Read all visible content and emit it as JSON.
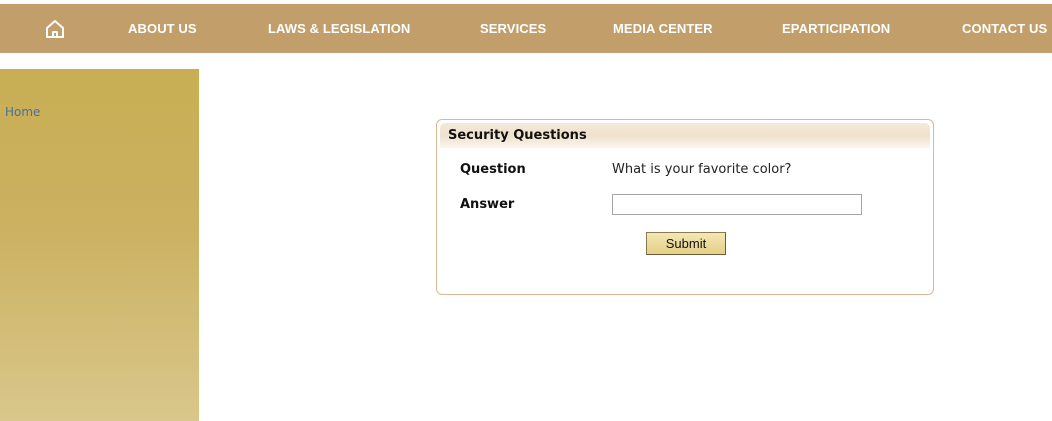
{
  "nav": {
    "home_icon": "home-icon",
    "items": [
      {
        "label": "ABOUT US"
      },
      {
        "label": "LAWS & LEGISLATION"
      },
      {
        "label": "SERVICES"
      },
      {
        "label": "MEDIA CENTER"
      },
      {
        "label": "EPARTICIPATION"
      },
      {
        "label": "CONTACT US"
      }
    ]
  },
  "sidebar": {
    "breadcrumb_home": "Home"
  },
  "security_panel": {
    "title": "Security Questions",
    "question_label": "Question",
    "question_text": "What is your favorite color?",
    "answer_label": "Answer",
    "answer_value": "",
    "submit_label": "Submit"
  },
  "colors": {
    "nav_background": "#c29f6a",
    "sidebar_gold": "#c8ae53",
    "link_blue": "#4a6fa5",
    "panel_border": "#d8b993",
    "button_gold": "#e5cf86"
  }
}
